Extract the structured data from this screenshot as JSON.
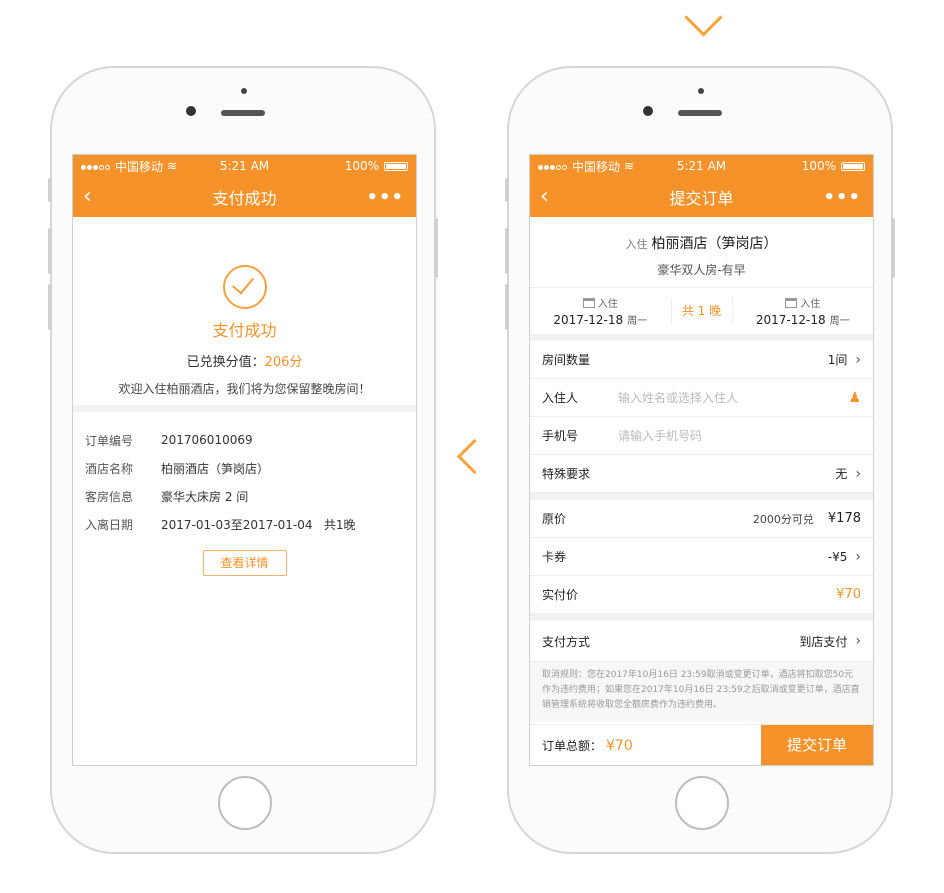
{
  "status_bar": {
    "carrier": "中国移动",
    "time": "5:21 AM",
    "battery": "100%"
  },
  "left_screen": {
    "nav_title": "支付成功",
    "back_symbol": "‹",
    "more_symbol": "•••",
    "success_title": "支付成功",
    "points_label": "已兑换分值：",
    "points_value": "206分",
    "welcome": "欢迎入住柏丽酒店，我们将为您保留整晚房间！",
    "info": [
      {
        "key": "订单编号",
        "value": "201706010069"
      },
      {
        "key": "酒店名称",
        "value": "柏丽酒店（笋岗店）"
      },
      {
        "key": "客房信息",
        "value": "豪华大床房 2 间"
      },
      {
        "key": "入离日期",
        "value": "2017-01-03至2017-01-04   共1晚"
      }
    ],
    "detail_button": "查看详情"
  },
  "right_screen": {
    "nav_title": "提交订单",
    "back_symbol": "‹",
    "more_symbol": "•••",
    "hotel_prefix": "入住",
    "hotel_name": "柏丽酒店（笋岗店）",
    "room_type": "豪华双人房-有早",
    "checkin": {
      "label": "入住",
      "date": "2017-12-18",
      "weekday": "周一"
    },
    "nights": "共 1 晚",
    "checkout": {
      "label": "入住",
      "date": "2017-12-18",
      "weekday": "周一"
    },
    "rows": {
      "room_count": {
        "label": "房间数量",
        "value": "1间"
      },
      "guest": {
        "label": "入住人",
        "placeholder": "输入姓名或选择入住人"
      },
      "phone": {
        "label": "手机号",
        "placeholder": "请输入手机号码"
      },
      "special": {
        "label": "特殊要求",
        "value": "无"
      },
      "original_price": {
        "label": "原价",
        "note": "2000分可兑",
        "value": "¥178"
      },
      "coupon": {
        "label": "卡券",
        "value": "-¥5"
      },
      "actual_price": {
        "label": "实付价",
        "value": "¥70"
      },
      "payment": {
        "label": "支付方式",
        "value": "到店支付"
      }
    },
    "policy": "取消规则：您在2017年10月16日 23:59取消或变更订单，酒店将扣取您50元作为违约费用；如果您在2017年10月16日 23:59之后取消或变更订单，酒店直销管理系统将收取您全额房费作为违约费用。",
    "total_label": "订单总额：",
    "total_value": "¥70",
    "submit_button": "提交订单"
  },
  "colors": {
    "accent": "#f6922a",
    "arrow": "#f5a43a"
  },
  "icons": [
    "chevron-down-icon",
    "chevron-left-icon",
    "check-circle-icon",
    "calendar-icon",
    "person-icon",
    "wifi-icon",
    "battery-icon"
  ]
}
